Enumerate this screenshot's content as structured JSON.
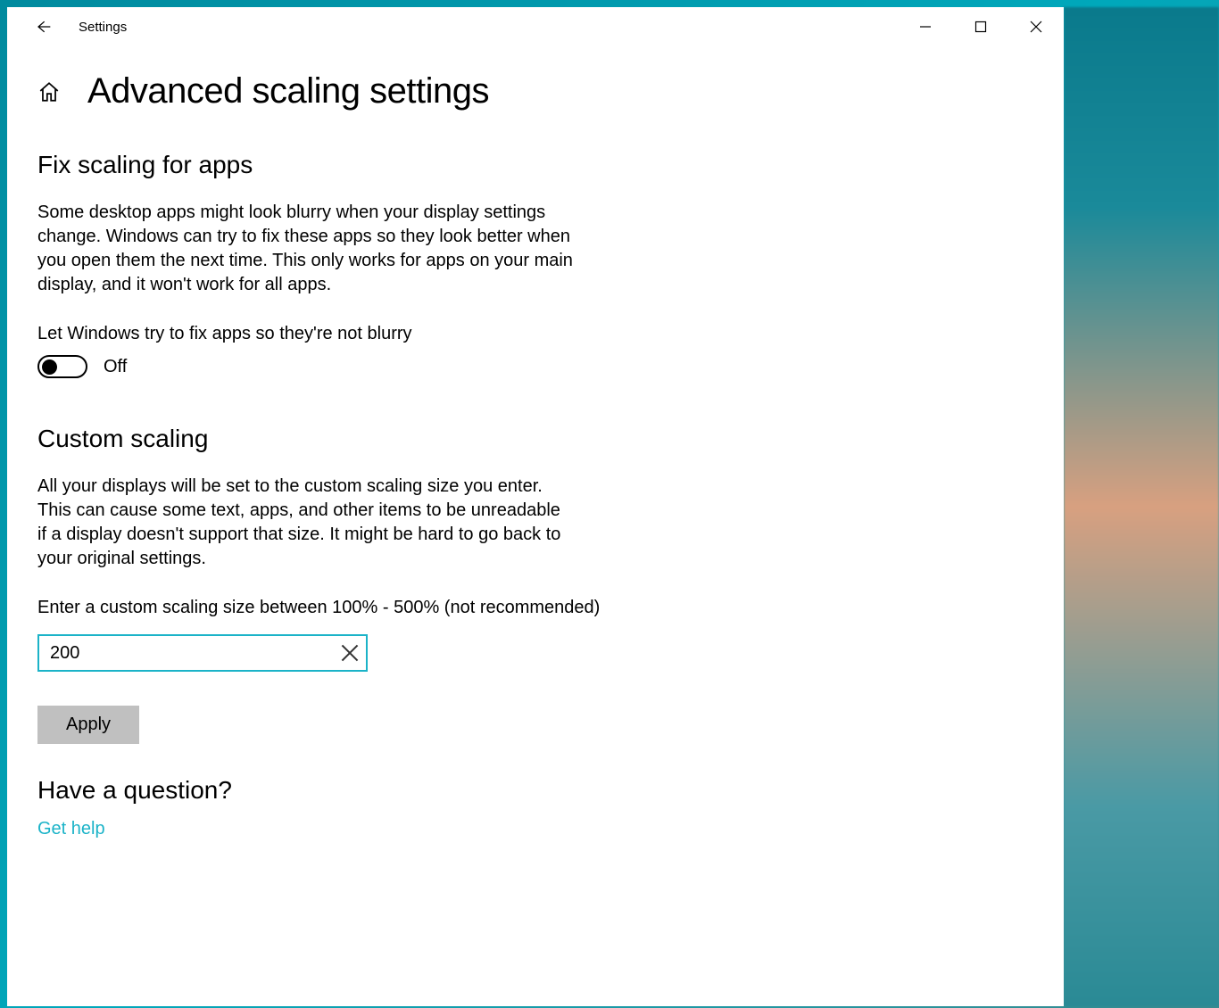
{
  "titlebar": {
    "title": "Settings"
  },
  "page": {
    "title": "Advanced scaling settings"
  },
  "fix_scaling": {
    "heading": "Fix scaling for apps",
    "description": "Some desktop apps might look blurry when your display settings change. Windows can try to fix these apps so they look better when you open them the next time. This only works for apps on your main display, and it won't work for all apps.",
    "toggle_label": "Let Windows try to fix apps so they're not blurry",
    "toggle_state": "Off"
  },
  "custom_scaling": {
    "heading": "Custom scaling",
    "description": "All your displays will be set to the custom scaling size you enter. This can cause some text, apps, and other items to be unreadable if a display doesn't support that size. It might be hard to go back to your original settings.",
    "input_label": "Enter a custom scaling size between 100% - 500% (not recommended)",
    "input_value": "200",
    "apply_label": "Apply"
  },
  "help": {
    "heading": "Have a question?",
    "link_label": "Get help"
  }
}
